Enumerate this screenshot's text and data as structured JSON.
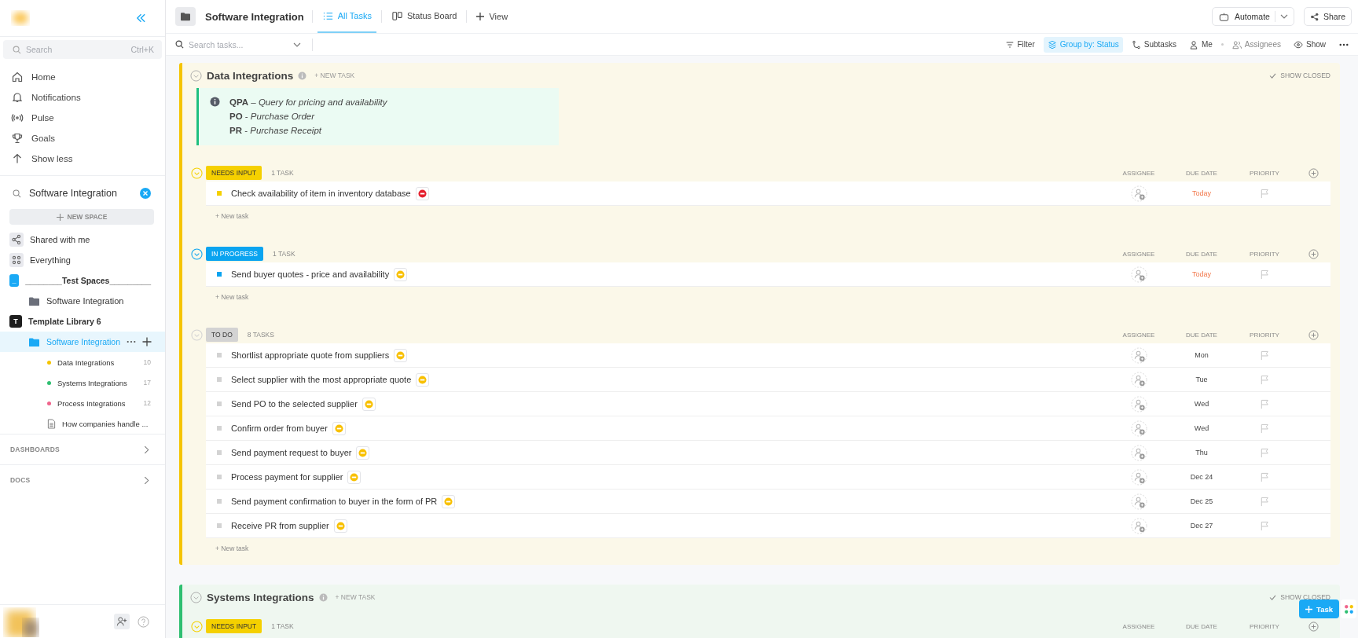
{
  "sidebar": {
    "search": {
      "placeholder": "Search",
      "shortcut": "Ctrl+K"
    },
    "nav": [
      {
        "label": "Home"
      },
      {
        "label": "Notifications"
      },
      {
        "label": "Pulse"
      },
      {
        "label": "Goals"
      },
      {
        "label": "Show less"
      }
    ],
    "filter": {
      "value": "Software Integration"
    },
    "new_space": "NEW SPACE",
    "tree": [
      {
        "label": "Shared with me",
        "kind": "shared",
        "selected": false
      },
      {
        "label": "Everything",
        "kind": "everything",
        "selected": false
      },
      {
        "label": "________Test Spaces_________",
        "kind": "space",
        "avatar": "_",
        "color": "#1aa9f5",
        "selected": false,
        "children": [
          {
            "label": "Software Integration",
            "kind": "folder",
            "selected": false
          }
        ]
      },
      {
        "label": "Template Library 6",
        "kind": "space",
        "avatar": "T",
        "color": "#1e1e1e",
        "selected": false,
        "children": [
          {
            "label": "Software Integration",
            "kind": "folder",
            "selected": true,
            "children": [
              {
                "label": "Data Integrations",
                "kind": "list",
                "color": "#f5c400",
                "count": "10",
                "selected": false
              },
              {
                "label": "Systems Integrations",
                "kind": "list",
                "color": "#2fbf71",
                "count": "17",
                "selected": false
              },
              {
                "label": "Process Integrations",
                "kind": "list",
                "color": "#f0648c",
                "count": "12",
                "selected": false
              },
              {
                "label": "How companies handle ...",
                "kind": "doc",
                "selected": false
              }
            ]
          }
        ]
      }
    ],
    "sections": [
      {
        "label": "DASHBOARDS"
      },
      {
        "label": "DOCS"
      }
    ]
  },
  "header": {
    "title": "Software Integration",
    "views": [
      {
        "label": "All Tasks",
        "selected": true
      },
      {
        "label": "Status Board",
        "selected": false
      }
    ],
    "add_view": "View",
    "automate": "Automate",
    "share": "Share"
  },
  "toolbar": {
    "search": {
      "placeholder": "Search tasks..."
    },
    "items": [
      {
        "label": "Filter",
        "selected": false
      },
      {
        "label": "Group by: Status",
        "selected": true
      },
      {
        "label": "Subtasks",
        "selected": false
      },
      {
        "label": "Me",
        "selected": false
      },
      {
        "label": "Assignees",
        "selected": false
      },
      {
        "label": "Show",
        "selected": false
      }
    ]
  },
  "groups": [
    {
      "title": "Data Integrations",
      "color": "#f5c400",
      "new_task": "+ NEW TASK",
      "show_closed": "SHOW CLOSED",
      "note": [
        "**QPA** – *Query for pricing and availability*",
        "**PO** - *Purchase Order*",
        "**PR** - *Purchase Receipt*"
      ],
      "statuses": [
        {
          "label": "NEEDS INPUT",
          "color": "#f5d000",
          "count": "1 TASK",
          "columns": [
            "ASSIGNEE",
            "DUE DATE",
            "PRIORITY"
          ],
          "new_task": "+ New task",
          "tasks": [
            {
              "title": "Check availability of item in inventory database",
              "color": "#e5202e",
              "due": "Today",
              "due_today": true
            }
          ]
        },
        {
          "label": "IN PROGRESS",
          "color": "#0aa4f0",
          "count": "1 TASK",
          "columns": [
            "ASSIGNEE",
            "DUE DATE",
            "PRIORITY"
          ],
          "new_task": "+ New task",
          "tasks": [
            {
              "title": "Send buyer quotes - price and availability",
              "color": "#f8c000",
              "due": "Today",
              "due_today": true
            }
          ]
        },
        {
          "label": "TO DO",
          "color": "#d3d3d3",
          "count": "8 TASKS",
          "columns": [
            "ASSIGNEE",
            "DUE DATE",
            "PRIORITY"
          ],
          "new_task": "+ New task",
          "tasks": [
            {
              "title": "Shortlist appropriate quote from suppliers",
              "color": "#f8c000",
              "due": "Mon",
              "due_today": false
            },
            {
              "title": "Select supplier with the most appropriate quote",
              "color": "#f8c000",
              "due": "Tue",
              "due_today": false
            },
            {
              "title": "Send PO to the selected supplier",
              "color": "#f8c000",
              "due": "Wed",
              "due_today": false
            },
            {
              "title": "Confirm order from buyer",
              "color": "#f8c000",
              "due": "Wed",
              "due_today": false
            },
            {
              "title": "Send payment request to buyer",
              "color": "#f8c000",
              "due": "Thu",
              "due_today": false
            },
            {
              "title": "Process payment for supplier",
              "color": "#f8c000",
              "due": "Dec 24",
              "due_today": false
            },
            {
              "title": "Send payment confirmation to buyer in the form of PR",
              "color": "#f8c000",
              "due": "Dec 25",
              "due_today": false
            },
            {
              "title": "Receive PR from supplier",
              "color": "#f8c000",
              "due": "Dec 27",
              "due_today": false
            }
          ]
        }
      ]
    },
    {
      "title": "Systems Integrations",
      "color": "#2fbf71",
      "new_task": "+ NEW TASK",
      "show_closed": "SHOW CLOSED",
      "statuses": [
        {
          "label": "NEEDS INPUT",
          "color": "#f5d000",
          "count": "1 TASK",
          "columns": [
            "ASSIGNEE",
            "DUE DATE",
            "PRIORITY"
          ]
        }
      ]
    }
  ],
  "fab": {
    "label": "Task"
  }
}
